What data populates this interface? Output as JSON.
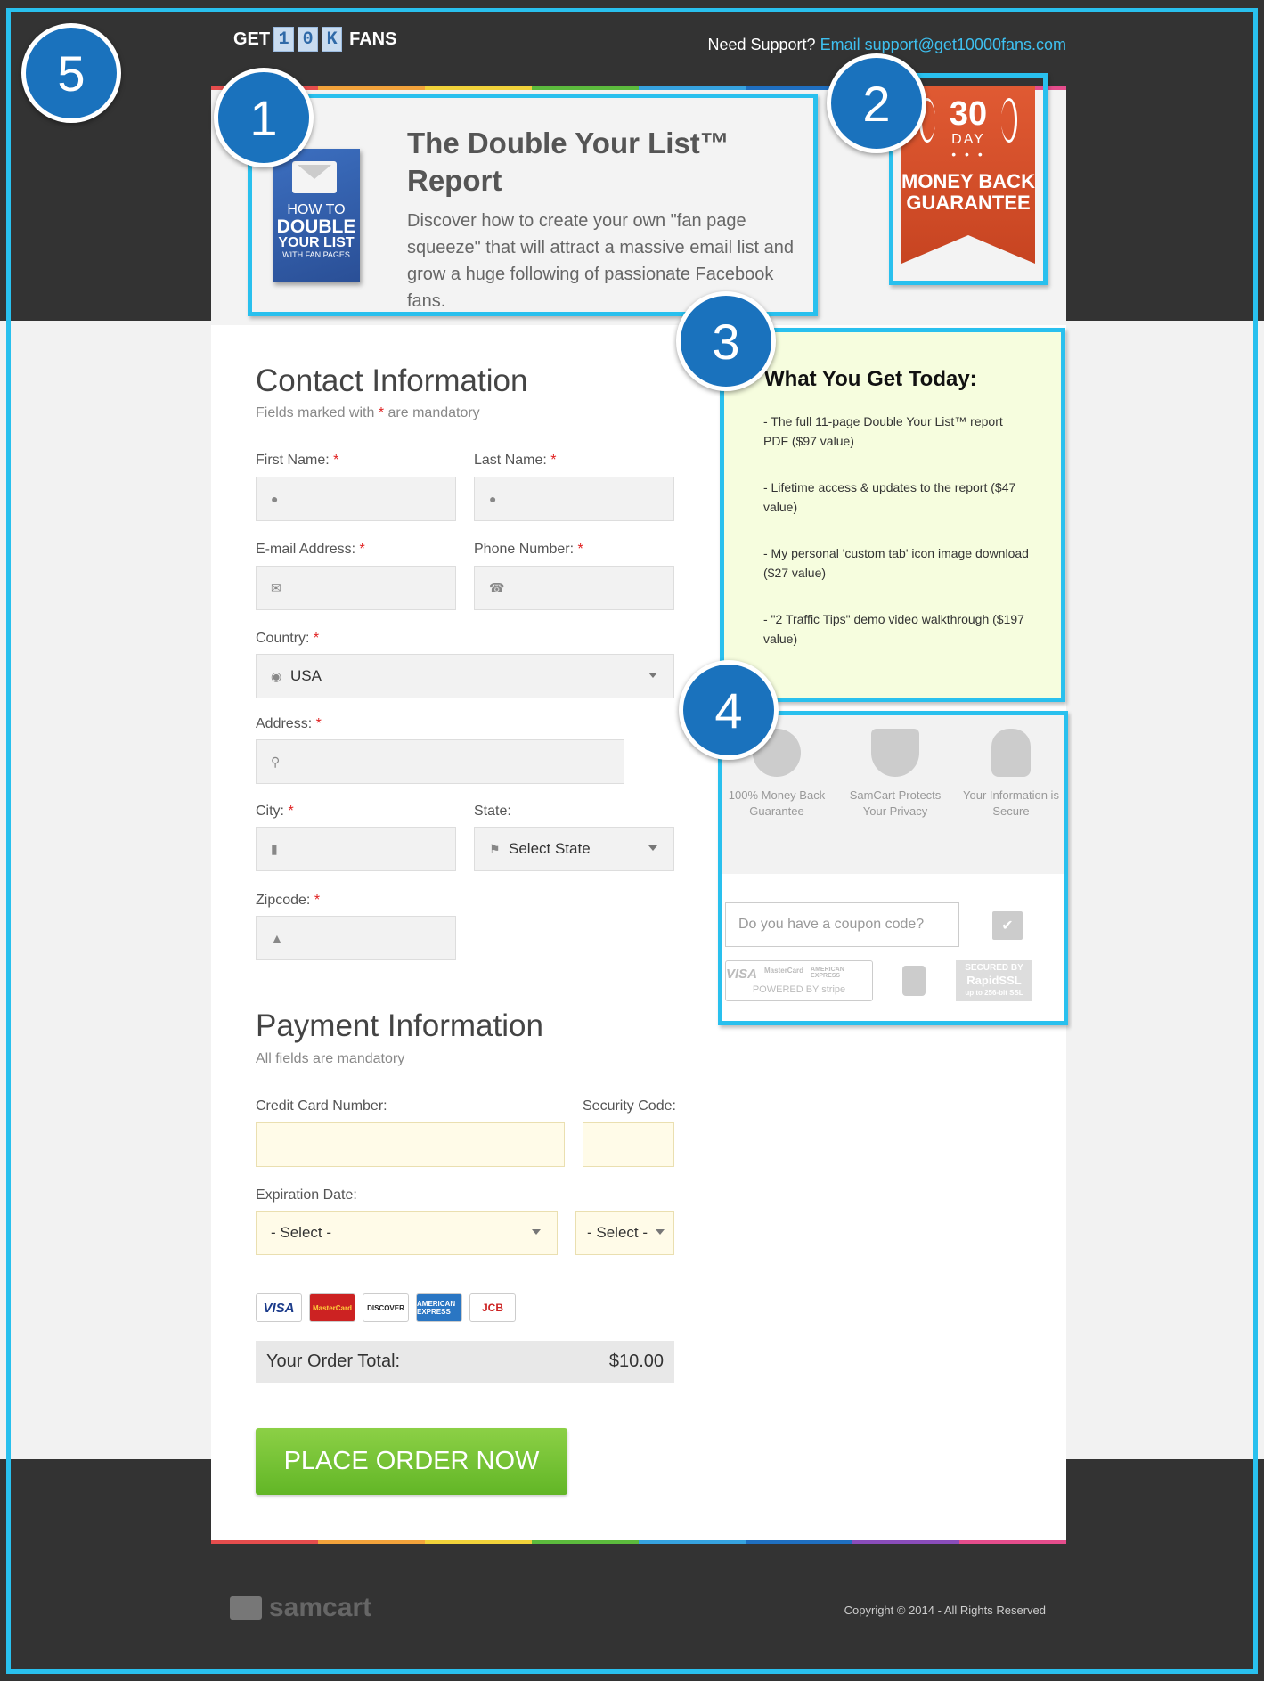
{
  "header": {
    "logo": {
      "prefix": "GET",
      "tiles": [
        "1",
        "0",
        "K"
      ],
      "suffix": "FANS"
    },
    "support_label": "Need Support?",
    "support_email_label": "Email support@get10000fans.com"
  },
  "product": {
    "cover": {
      "line1": "HOW TO",
      "line2": "DOUBLE",
      "line3": "YOUR LIST",
      "line4": "WITH FAN PAGES"
    },
    "title": "The Double Your List™ Report",
    "description": "Discover how to create your own \"fan page squeeze\" that will attract a massive email list and grow a huge following of passionate Facebook fans."
  },
  "guarantee": {
    "days": "30",
    "day_label": "DAY",
    "line1": "MONEY BACK",
    "line2": "GUARANTEE"
  },
  "callouts": [
    "5",
    "1",
    "2",
    "3",
    "4"
  ],
  "contact": {
    "title": "Contact Information",
    "subtitle_prefix": "Fields marked with",
    "subtitle_star": "*",
    "subtitle_suffix": "are mandatory",
    "first_name_label": "First Name:",
    "last_name_label": "Last Name:",
    "email_label": "E-mail Address:",
    "phone_label": "Phone Number:",
    "country_label": "Country:",
    "country_value": "USA",
    "address_label": "Address:",
    "city_label": "City:",
    "state_label": "State:",
    "state_value": "Select State",
    "zip_label": "Zipcode:",
    "required_mark": "*"
  },
  "payment": {
    "title": "Payment Information",
    "subtitle": "All fields are mandatory",
    "card_number_label": "Credit Card Number:",
    "security_code_label": "Security Code:",
    "expiration_label": "Expiration Date:",
    "month_value": "- Select -",
    "year_value": "- Select -",
    "card_logos": [
      "VISA",
      "MasterCard",
      "DISCOVER",
      "AMERICAN EXPRESS",
      "JCB"
    ],
    "total_label": "Your Order Total:",
    "total_value": "$10.00",
    "place_order_label": "PLACE ORDER NOW"
  },
  "benefits": {
    "title": "What You Get Today:",
    "items": [
      "- The full 11-page Double Your List™ report PDF ($97 value)",
      "- Lifetime access & updates to the report ($47 value)",
      "- My personal 'custom tab' icon image download ($27 value)",
      "- \"2 Traffic Tips\" demo video walkthrough ($197 value)"
    ]
  },
  "trust": {
    "items": [
      "100% Money Back Guarantee",
      "SamCart Protects Your Privacy",
      "Your Information is Secure"
    ],
    "coupon_placeholder": "Do you have a coupon code?",
    "stripe_cards": [
      "VISA",
      "MasterCard",
      "AMERICAN EXPRESS"
    ],
    "stripe_label": "POWERED BY stripe",
    "rapid_line1": "SECURED BY",
    "rapid_line2": "RapidSSL",
    "rapid_line3": "up to 256-bit SSL"
  },
  "footer": {
    "brand": "samcart",
    "copyright": "Copyright © 2014 - All Rights Reserved"
  },
  "colors": {
    "accent": "#29c0ee",
    "callout": "#1a72bd",
    "order_button": "#6ec22e",
    "ribbon": "#d24e29",
    "link": "#3ec0f0"
  }
}
